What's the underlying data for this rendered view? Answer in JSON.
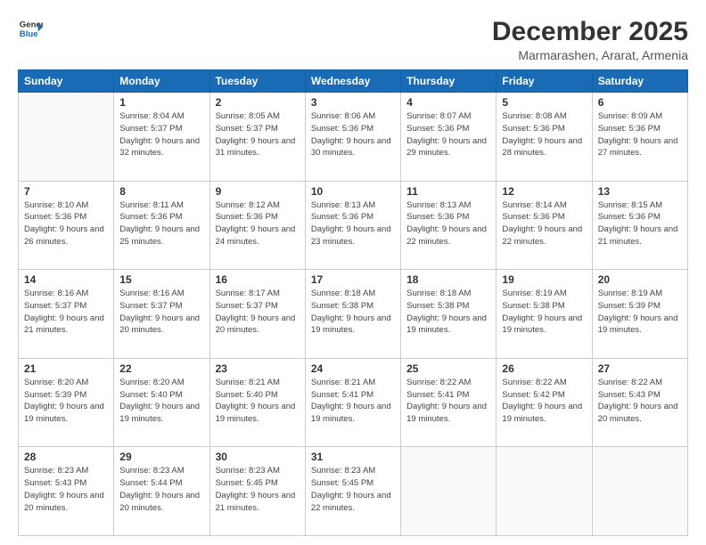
{
  "header": {
    "logo_line1": "General",
    "logo_line2": "Blue",
    "title": "December 2025",
    "subtitle": "Marmarashen, Ararat, Armenia"
  },
  "weekdays": [
    "Sunday",
    "Monday",
    "Tuesday",
    "Wednesday",
    "Thursday",
    "Friday",
    "Saturday"
  ],
  "weeks": [
    [
      {
        "day": "",
        "sunrise": "",
        "sunset": "",
        "daylight": ""
      },
      {
        "day": "1",
        "sunrise": "8:04 AM",
        "sunset": "5:37 PM",
        "daylight": "9 hours and 32 minutes."
      },
      {
        "day": "2",
        "sunrise": "8:05 AM",
        "sunset": "5:37 PM",
        "daylight": "9 hours and 31 minutes."
      },
      {
        "day": "3",
        "sunrise": "8:06 AM",
        "sunset": "5:36 PM",
        "daylight": "9 hours and 30 minutes."
      },
      {
        "day": "4",
        "sunrise": "8:07 AM",
        "sunset": "5:36 PM",
        "daylight": "9 hours and 29 minutes."
      },
      {
        "day": "5",
        "sunrise": "8:08 AM",
        "sunset": "5:36 PM",
        "daylight": "9 hours and 28 minutes."
      },
      {
        "day": "6",
        "sunrise": "8:09 AM",
        "sunset": "5:36 PM",
        "daylight": "9 hours and 27 minutes."
      }
    ],
    [
      {
        "day": "7",
        "sunrise": "8:10 AM",
        "sunset": "5:36 PM",
        "daylight": "9 hours and 26 minutes."
      },
      {
        "day": "8",
        "sunrise": "8:11 AM",
        "sunset": "5:36 PM",
        "daylight": "9 hours and 25 minutes."
      },
      {
        "day": "9",
        "sunrise": "8:12 AM",
        "sunset": "5:36 PM",
        "daylight": "9 hours and 24 minutes."
      },
      {
        "day": "10",
        "sunrise": "8:13 AM",
        "sunset": "5:36 PM",
        "daylight": "9 hours and 23 minutes."
      },
      {
        "day": "11",
        "sunrise": "8:13 AM",
        "sunset": "5:36 PM",
        "daylight": "9 hours and 22 minutes."
      },
      {
        "day": "12",
        "sunrise": "8:14 AM",
        "sunset": "5:36 PM",
        "daylight": "9 hours and 22 minutes."
      },
      {
        "day": "13",
        "sunrise": "8:15 AM",
        "sunset": "5:36 PM",
        "daylight": "9 hours and 21 minutes."
      }
    ],
    [
      {
        "day": "14",
        "sunrise": "8:16 AM",
        "sunset": "5:37 PM",
        "daylight": "9 hours and 21 minutes."
      },
      {
        "day": "15",
        "sunrise": "8:16 AM",
        "sunset": "5:37 PM",
        "daylight": "9 hours and 20 minutes."
      },
      {
        "day": "16",
        "sunrise": "8:17 AM",
        "sunset": "5:37 PM",
        "daylight": "9 hours and 20 minutes."
      },
      {
        "day": "17",
        "sunrise": "8:18 AM",
        "sunset": "5:38 PM",
        "daylight": "9 hours and 19 minutes."
      },
      {
        "day": "18",
        "sunrise": "8:18 AM",
        "sunset": "5:38 PM",
        "daylight": "9 hours and 19 minutes."
      },
      {
        "day": "19",
        "sunrise": "8:19 AM",
        "sunset": "5:38 PM",
        "daylight": "9 hours and 19 minutes."
      },
      {
        "day": "20",
        "sunrise": "8:19 AM",
        "sunset": "5:39 PM",
        "daylight": "9 hours and 19 minutes."
      }
    ],
    [
      {
        "day": "21",
        "sunrise": "8:20 AM",
        "sunset": "5:39 PM",
        "daylight": "9 hours and 19 minutes."
      },
      {
        "day": "22",
        "sunrise": "8:20 AM",
        "sunset": "5:40 PM",
        "daylight": "9 hours and 19 minutes."
      },
      {
        "day": "23",
        "sunrise": "8:21 AM",
        "sunset": "5:40 PM",
        "daylight": "9 hours and 19 minutes."
      },
      {
        "day": "24",
        "sunrise": "8:21 AM",
        "sunset": "5:41 PM",
        "daylight": "9 hours and 19 minutes."
      },
      {
        "day": "25",
        "sunrise": "8:22 AM",
        "sunset": "5:41 PM",
        "daylight": "9 hours and 19 minutes."
      },
      {
        "day": "26",
        "sunrise": "8:22 AM",
        "sunset": "5:42 PM",
        "daylight": "9 hours and 19 minutes."
      },
      {
        "day": "27",
        "sunrise": "8:22 AM",
        "sunset": "5:43 PM",
        "daylight": "9 hours and 20 minutes."
      }
    ],
    [
      {
        "day": "28",
        "sunrise": "8:23 AM",
        "sunset": "5:43 PM",
        "daylight": "9 hours and 20 minutes."
      },
      {
        "day": "29",
        "sunrise": "8:23 AM",
        "sunset": "5:44 PM",
        "daylight": "9 hours and 20 minutes."
      },
      {
        "day": "30",
        "sunrise": "8:23 AM",
        "sunset": "5:45 PM",
        "daylight": "9 hours and 21 minutes."
      },
      {
        "day": "31",
        "sunrise": "8:23 AM",
        "sunset": "5:45 PM",
        "daylight": "9 hours and 22 minutes."
      },
      {
        "day": "",
        "sunrise": "",
        "sunset": "",
        "daylight": ""
      },
      {
        "day": "",
        "sunrise": "",
        "sunset": "",
        "daylight": ""
      },
      {
        "day": "",
        "sunrise": "",
        "sunset": "",
        "daylight": ""
      }
    ]
  ],
  "labels": {
    "sunrise_prefix": "Sunrise: ",
    "sunset_prefix": "Sunset: ",
    "daylight_prefix": "Daylight: "
  }
}
